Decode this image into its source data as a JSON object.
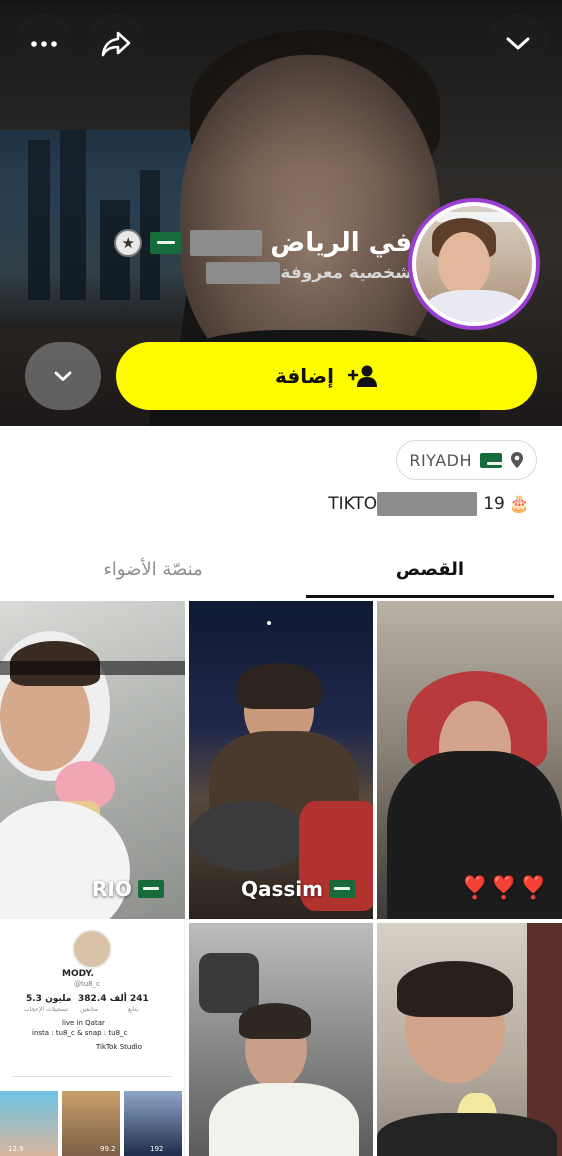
{
  "hero": {
    "display_name_suffix": "في الرياض",
    "subtitle": "شخصية معروفة",
    "add_button_label": "إضافة"
  },
  "profile": {
    "location": "RIYADH",
    "bio_prefix": "TIKTO",
    "bio_suffix": "19"
  },
  "tabs": [
    {
      "label": "القصص",
      "active": true
    },
    {
      "label": "منصّة الأضواء",
      "active": false
    }
  ],
  "stories": [
    {
      "label": "RIO",
      "badge": "saudi-flag"
    },
    {
      "label": "Qassim",
      "badge": "saudi-flag"
    },
    {
      "label": "❣️❣️❣️",
      "badge": ""
    },
    {
      "label": "",
      "badge": ""
    },
    {
      "label": "",
      "badge": ""
    },
    {
      "label": "",
      "badge": ""
    }
  ],
  "tiktok_preview": {
    "username": "MODY.",
    "handle": "@tu8_c",
    "stats": [
      {
        "value": "5.3 مليون",
        "label": "تسجيلات الإعجاب"
      },
      {
        "value": "382.4 ألف",
        "label": "متابعين"
      },
      {
        "value": "241",
        "label": "يتابع"
      }
    ],
    "bio_line1": "live in Qatar",
    "bio_line2": "insta : tu8_c & snap : tu8_c",
    "studio": "TikTok Studio",
    "views": [
      "12.9",
      "99.2",
      "192"
    ]
  },
  "icons": {
    "more": "more-horizontal-icon",
    "share": "share-arrow-icon",
    "close": "chevron-down-icon",
    "add_friend": "add-friend-icon",
    "location": "location-pin-icon",
    "star": "star-icon"
  },
  "colors": {
    "add_button_bg": "#fffc00",
    "avatar_ring": "#9b3fd3",
    "flag_green": "#176b3a",
    "heart_red": "#e2242f"
  }
}
